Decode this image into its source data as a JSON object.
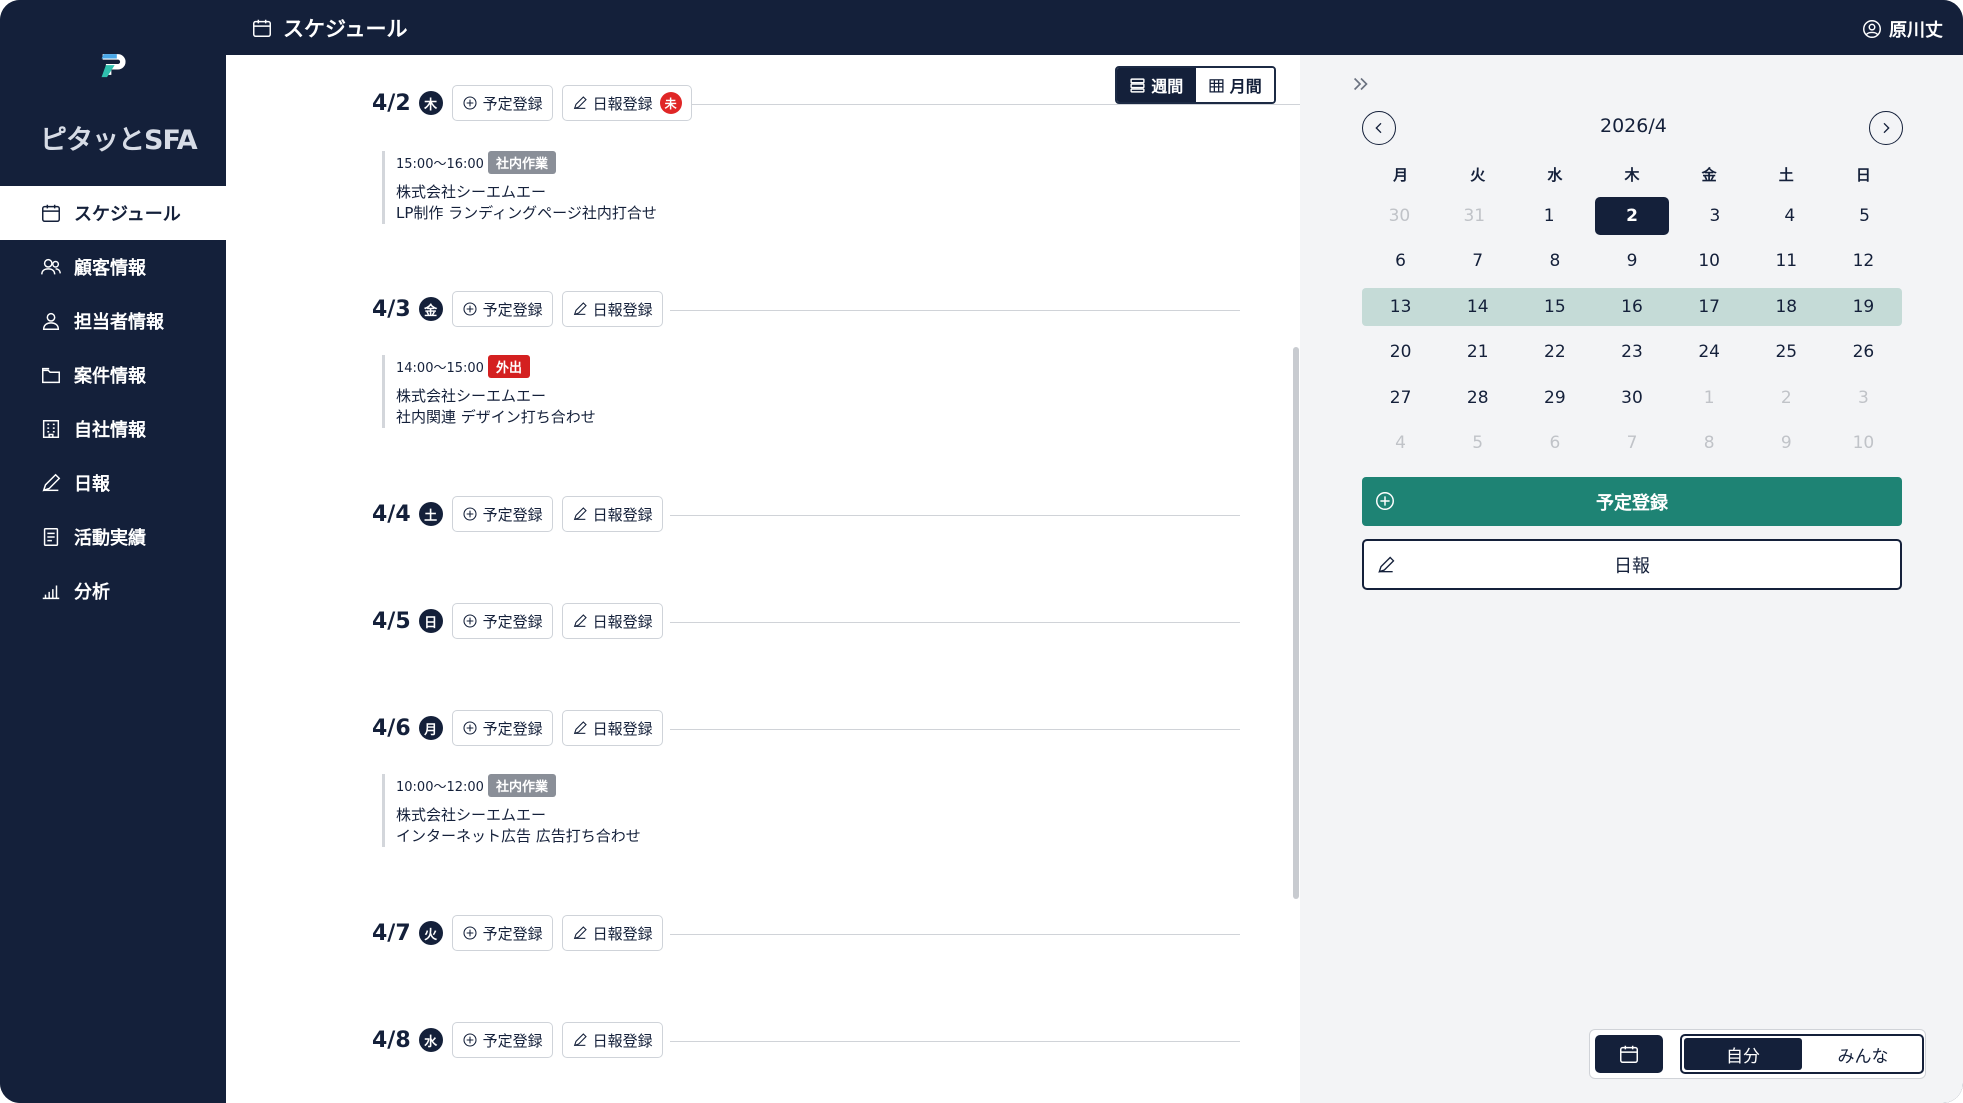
{
  "app": {
    "title": "スケジュール",
    "user_name": "原川丈",
    "logo_text": "ピタッとSFA"
  },
  "sidebar": {
    "items": [
      {
        "label": "スケジュール",
        "icon": "calendar-icon",
        "active": true
      },
      {
        "label": "顧客情報",
        "icon": "users-icon"
      },
      {
        "label": "担当者情報",
        "icon": "user-icon"
      },
      {
        "label": "案件情報",
        "icon": "folder-icon"
      },
      {
        "label": "自社情報",
        "icon": "building-icon"
      },
      {
        "label": "日報",
        "icon": "pencil-icon"
      },
      {
        "label": "活動実績",
        "icon": "document-icon"
      },
      {
        "label": "分析",
        "icon": "bar-chart-icon"
      }
    ]
  },
  "view_toggle": {
    "week": "週間",
    "month": "月間",
    "selected": "week"
  },
  "buttons": {
    "schedule_add": "予定登録",
    "report_add": "日報登録",
    "unsubmitted_badge": "未"
  },
  "days": [
    {
      "date": "4/2",
      "dow": "木",
      "unsubmitted": true,
      "events": [
        {
          "time": "15:00〜16:00",
          "tag": "社内作業",
          "tag_color": "#8a8f98",
          "company": "株式会社シーエムエー",
          "detail": "LP制作 ランディングページ社内打合せ"
        }
      ]
    },
    {
      "date": "4/3",
      "dow": "金",
      "events": [
        {
          "time": "14:00〜15:00",
          "tag": "外出",
          "tag_color": "#d42020",
          "company": "株式会社シーエムエー",
          "detail": "社内関連 デザイン打ち合わせ"
        }
      ]
    },
    {
      "date": "4/4",
      "dow": "土",
      "events": []
    },
    {
      "date": "4/5",
      "dow": "日",
      "events": []
    },
    {
      "date": "4/6",
      "dow": "月",
      "events": [
        {
          "time": "10:00〜12:00",
          "tag": "社内作業",
          "tag_color": "#8a8f98",
          "company": "株式会社シーエムエー",
          "detail": "インターネット広告 広告打ち合わせ"
        }
      ]
    },
    {
      "date": "4/7",
      "dow": "火",
      "events": []
    },
    {
      "date": "4/8",
      "dow": "水",
      "events": []
    }
  ],
  "calendar": {
    "title": "2026/4",
    "weekday_headers": [
      "月",
      "火",
      "水",
      "木",
      "金",
      "土",
      "日"
    ],
    "weeks": [
      [
        "30",
        "31",
        "1",
        "2",
        "3",
        "4",
        "5"
      ],
      [
        "6",
        "7",
        "8",
        "9",
        "10",
        "11",
        "12"
      ],
      [
        "13",
        "14",
        "15",
        "16",
        "17",
        "18",
        "19"
      ],
      [
        "20",
        "21",
        "22",
        "23",
        "24",
        "25",
        "26"
      ],
      [
        "27",
        "28",
        "29",
        "30",
        "1",
        "2",
        "3"
      ],
      [
        "4",
        "5",
        "6",
        "7",
        "8",
        "9",
        "10"
      ]
    ],
    "dim_cells": [
      [
        0,
        0
      ],
      [
        0,
        1
      ],
      [
        4,
        4
      ],
      [
        4,
        5
      ],
      [
        4,
        6
      ],
      [
        5,
        0
      ],
      [
        5,
        1
      ],
      [
        5,
        2
      ],
      [
        5,
        3
      ],
      [
        5,
        4
      ],
      [
        5,
        5
      ],
      [
        5,
        6
      ]
    ],
    "today": [
      0,
      3
    ],
    "highlight_week": 2
  },
  "panel": {
    "schedule_button": "予定登録",
    "report_button": "日報"
  },
  "scope_toggle": {
    "mine": "自分",
    "everyone": "みんな",
    "selected": "mine"
  },
  "colors": {
    "navy": "#14203a",
    "primary": "#1e8374",
    "week_highlight": "#c5dbd7",
    "alert_red": "#e02626"
  }
}
